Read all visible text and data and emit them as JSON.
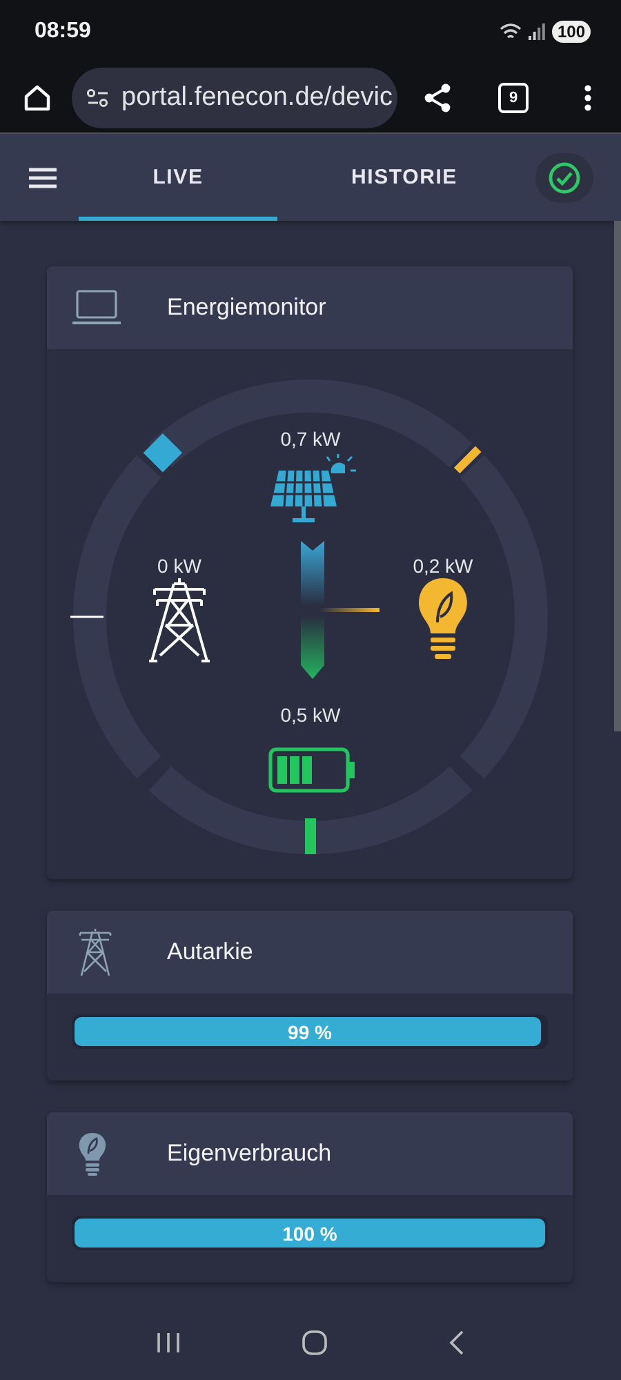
{
  "status_bar": {
    "time": "08:59",
    "battery": "100"
  },
  "browser": {
    "url": "portal.fenecon.de/devic",
    "tab_count": "9"
  },
  "tabs": [
    {
      "label": "LIVE",
      "selected": true
    },
    {
      "label": "HISTORIE",
      "selected": false
    }
  ],
  "energy_monitor": {
    "title": "Energiemonitor",
    "nodes": [
      {
        "kind": "solar",
        "value": "0,7 kW"
      },
      {
        "kind": "grid",
        "value": "0 kW"
      },
      {
        "kind": "consumption",
        "value": "0,2 kW"
      },
      {
        "kind": "storage",
        "value": "0,5 kW"
      }
    ]
  },
  "widgets": [
    {
      "kind": "grid",
      "title": "Autarkie",
      "level": 0.99,
      "reading": "99 %"
    },
    {
      "kind": "consumption",
      "title": "Eigenverbrauch",
      "level": 1,
      "reading": "100 %"
    }
  ]
}
